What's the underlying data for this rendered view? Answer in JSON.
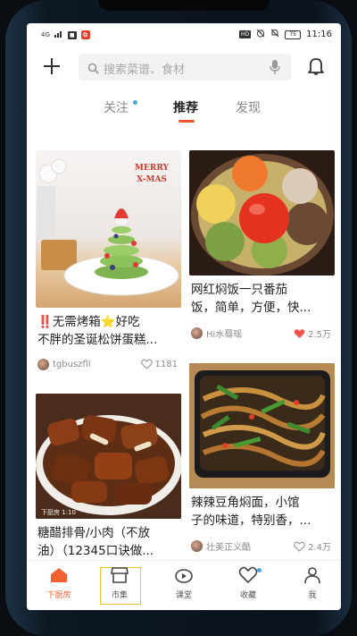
{
  "status_bar": {
    "network": "4G",
    "signal_text": "ail",
    "hd_label": "HD",
    "battery_level": "75",
    "time": "11:16"
  },
  "topbar": {
    "search_placeholder": "搜索菜谱、食材"
  },
  "tabs": [
    {
      "label": "关注",
      "has_dot": true
    },
    {
      "label": "推荐",
      "active": true
    },
    {
      "label": "发现"
    }
  ],
  "feed": {
    "cards": [
      {
        "title_line1": "‼️无需烤箱⭐好吃",
        "title_line2": "不胖的圣诞松饼蛋糕...",
        "author": "tgbuszfll",
        "likes": "1181",
        "liked": false,
        "image_label": "MERRY X-MAS"
      },
      {
        "title_line1": "网红焖饭一只番茄",
        "title_line2": "饭，简单，方便，快...",
        "author": "Hi水蓦瑶",
        "likes": "2.5万",
        "liked": true
      },
      {
        "title_line1": "糖醋排骨/小肉（不放",
        "title_line2": "油）（12345口诀做...",
        "author": "",
        "likes": "",
        "watermark": "下厨房 1:10"
      },
      {
        "title_line1": "辣辣豆角焖面，小馆",
        "title_line2": "子的味道，特别香，...",
        "author": "壮美正义酷",
        "likes": "2.4万",
        "liked": false
      }
    ]
  },
  "bottom_nav": [
    {
      "label": "下厨房",
      "active": true
    },
    {
      "label": "市集",
      "highlighted": true
    },
    {
      "label": "课堂"
    },
    {
      "label": "收藏",
      "has_dot": true
    },
    {
      "label": "我"
    }
  ],
  "colors": {
    "accent": "#e8572c",
    "dot_blue": "#4aa8e0",
    "liked_red": "#f2534a",
    "highlight_yellow": "#f2c230"
  }
}
